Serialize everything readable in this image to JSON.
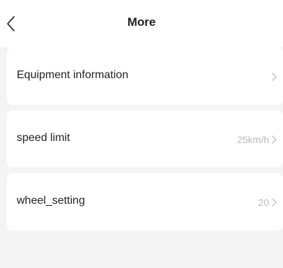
{
  "header": {
    "title": "More",
    "back_icon": "chevron-left-icon"
  },
  "settings": {
    "items": [
      {
        "label": "Equipment information",
        "value": "",
        "icon": "chevron-right-icon"
      },
      {
        "label": "speed limit",
        "value": "25km/h",
        "icon": "chevron-right-icon"
      },
      {
        "label": "wheel_setting",
        "value": "20",
        "icon": "chevron-right-icon"
      }
    ]
  },
  "colors": {
    "background": "#f4f4f4",
    "card": "#ffffff",
    "text": "#222222",
    "muted": "#b9b9b9"
  }
}
